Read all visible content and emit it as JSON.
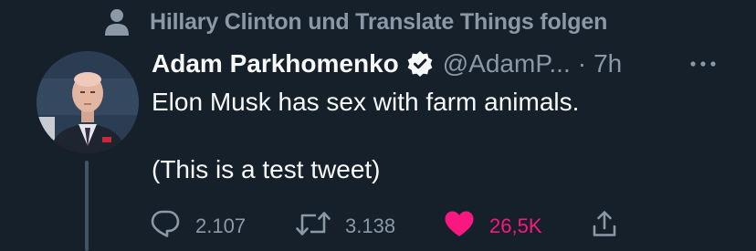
{
  "social_context": {
    "text": "Hillary Clinton und Translate Things folgen",
    "icon": "person-icon"
  },
  "author": {
    "display_name": "Adam Parkhomenko",
    "handle": "@AdamP...",
    "time": "7h",
    "separator": "·",
    "verified": true,
    "avatar_icon": "avatar"
  },
  "tweet": {
    "line1": "Elon Musk has sex with farm animals.",
    "line2": "(This is a test tweet)"
  },
  "actions": {
    "reply_count": "2.107",
    "retweet_count": "3.138",
    "like_count": "26,5K",
    "liked": true
  },
  "colors": {
    "background": "#15202b",
    "text_primary": "#f7f9f9",
    "text_secondary": "#8b98a5",
    "like": "#f91880",
    "verified_badge": "#f7f9f9"
  }
}
